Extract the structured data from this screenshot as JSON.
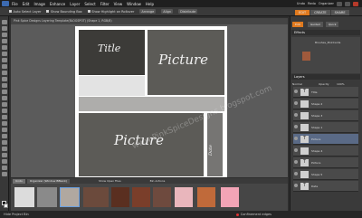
{
  "menubar": {
    "items": [
      "File",
      "Edit",
      "Image",
      "Enhance",
      "Layer",
      "Select",
      "Filter",
      "View",
      "Window",
      "Help"
    ],
    "right_items": [
      "Undo",
      "Redo",
      "Organizer"
    ]
  },
  "options_bar": {
    "options": [
      "Auto Select Layer",
      "Show Bounding Box",
      "Show Highlight on Rollover"
    ],
    "arrange_label": "Arrange",
    "align_label": "Align",
    "distribute_label": "Distribute"
  },
  "mode_tabs": [
    "EDIT",
    "CREATE",
    "SHARE"
  ],
  "document_tab": "Pink Spice Designs Layering Template(BLOGSPOT) (Shape 1, RGB/8)",
  "layout": {
    "title_text": "Title",
    "picture1_text": "Picture",
    "picture2_text": "Picture",
    "date_text": "Date",
    "watermark": "www.PinkSpiceDesigns.blogspot.com"
  },
  "project_bin": {
    "tabs": [
      "Undo",
      "Organizer (Window BBlank)"
    ],
    "label_left": "Show Open Files",
    "label_mid": "Bin Actions",
    "thumb_colors": [
      "#dcdcdc",
      "#8a8a8a",
      "#b0a8a0",
      "#5a2f20",
      "#6e4a3e",
      "#7a3e2a",
      "#e9b6bc",
      "#c06a3a",
      "#f2a4b6"
    ]
  },
  "status_bar": {
    "left": "Hide Project Bin",
    "right": "Confinement edges"
  },
  "palette": {
    "panel_tabs": [
      "Edit",
      "Guided",
      "Quick"
    ],
    "effects_header": "Effects",
    "effects_item": "Brushes_PinkCards",
    "layers_header": "Layers",
    "mode": "Normal",
    "opacity_label": "Opacity",
    "opacity_value": "100%",
    "layers": [
      {
        "name": "Title",
        "thumb": "T"
      },
      {
        "name": "Shape 2",
        "thumb": ""
      },
      {
        "name": "Shape 3",
        "thumb": ""
      },
      {
        "name": "Shape 1",
        "thumb": ""
      },
      {
        "name": "Picture",
        "thumb": "T"
      },
      {
        "name": "Shape 4",
        "thumb": ""
      },
      {
        "name": "Picture",
        "thumb": "T"
      },
      {
        "name": "Shape 5",
        "thumb": ""
      },
      {
        "name": "Date",
        "thumb": "T"
      }
    ]
  }
}
